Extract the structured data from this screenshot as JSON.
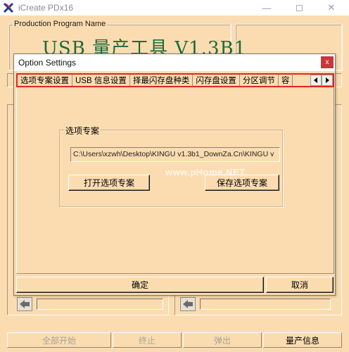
{
  "window": {
    "title": "iCreate PDx16",
    "minimize_glyph": "—",
    "close_glyph": "✕"
  },
  "main": {
    "program_group_label": "Production Program Name",
    "program_name": "USB 量产工具 V1.3B1"
  },
  "bottom_buttons": {
    "start_all": "全部开始",
    "stop": "终止",
    "eject": "弹出",
    "production_info": "量产信息"
  },
  "dialog": {
    "title": "Option Settings",
    "close_label": "x",
    "tabs": [
      {
        "label": "选项专案设置"
      },
      {
        "label": "USB 信息设置"
      },
      {
        "label": "择最闪存盘种类"
      },
      {
        "label": "闪存盘设置"
      },
      {
        "label": "分区调节"
      },
      {
        "label": "容"
      }
    ],
    "project_group_label": "选项专案",
    "project_path": "C:\\Users\\xzwh\\Desktop\\KINGU v1.3b1_DownZa.Cn\\KINGU v",
    "watermark": "www.pHome.NET",
    "open_project": "打开选项专案",
    "save_project": "保存选项专案",
    "ok": "确定",
    "cancel": "取消"
  },
  "colors": {
    "background": "#fbdcb0",
    "title_green": "#1e6a3a",
    "tab_highlight": "#e62520",
    "close_red": "#c8373a"
  },
  "icons": {
    "app": "pdx-app-icon",
    "tab_left": "triangle-left-icon",
    "tab_right": "triangle-right-icon",
    "port_arrow": "arrow-left-icon"
  }
}
